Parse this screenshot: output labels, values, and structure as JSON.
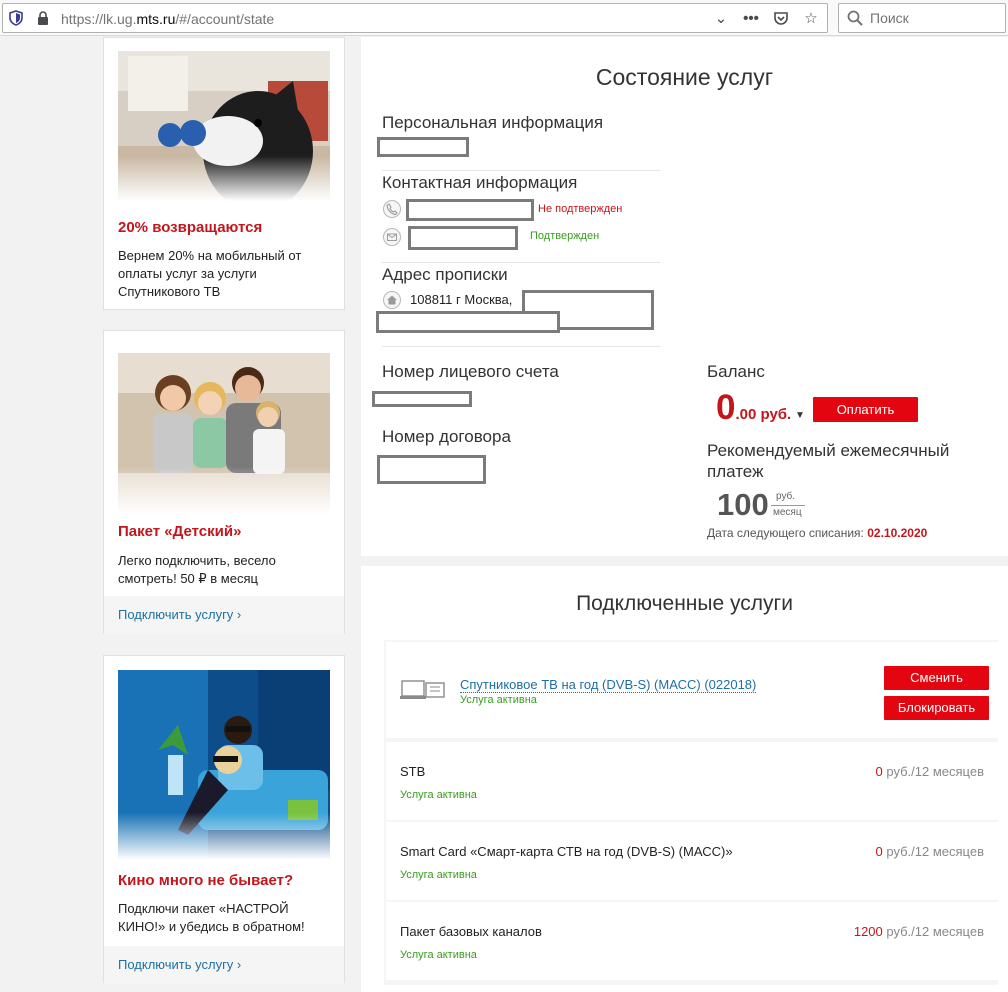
{
  "browser": {
    "url_prefix": "https://lk.ug.",
    "url_domain": "mts.ru",
    "url_suffix": "/#/account/state",
    "search_placeholder": "Поиск"
  },
  "promos": [
    {
      "title": "20% возвращаются",
      "text": "Вернем 20% на мобильный от оплаты услуг за услуги Спутникового ТВ"
    },
    {
      "title": "Пакет «Детский»",
      "text": "Легко подключить, весело смотреть! 50 ₽ в месяц",
      "link": "Подключить услугу ›"
    },
    {
      "title": "Кино много не бывает?",
      "text": "Подключи пакет «НАСТРОЙ КИНО!» и убедись в обратном!",
      "link": "Подключить услугу ›"
    }
  ],
  "state": {
    "title": "Состояние услуг",
    "personal_title": "Персональная информация",
    "contact_title": "Контактная информация",
    "phone_status": "Не подтвержден",
    "email_status": "Подтвержден",
    "address_title": "Адрес прописки",
    "address_text": "108811 г Москва,",
    "account_title": "Номер лицевого счета",
    "contract_title": "Номер договора",
    "balance_title": "Баланс",
    "balance_int": "0",
    "balance_frac": ".00 руб.",
    "pay_button": "Оплатить",
    "recommended_title": "Рекомендуемый ежемесячный платеж",
    "recommended_value": "100",
    "recommended_unit_top": "руб.",
    "recommended_unit_bottom": "месяц",
    "next_charge_label": "Дата следующего списания:",
    "next_charge_date": "02.10.2020"
  },
  "services": {
    "title": "Подключенные услуги",
    "main": {
      "name": "Спутниковое ТВ на год (DVB-S) (МАСС) (022018)",
      "status": "Услуга активна",
      "change_button": "Сменить",
      "block_button": "Блокировать"
    },
    "items": [
      {
        "name": "STB",
        "status": "Услуга активна",
        "price": "0",
        "unit": " руб./12 месяцев"
      },
      {
        "name": "Smart Card «Смарт-карта СТВ на год (DVB-S) (МАСС)»",
        "status": "Услуга активна",
        "price": "0",
        "unit": " руб./12 месяцев"
      },
      {
        "name": "Пакет базовых каналов",
        "status": "Услуга активна",
        "price": "1200",
        "unit": " руб./12 месяцев"
      }
    ]
  }
}
